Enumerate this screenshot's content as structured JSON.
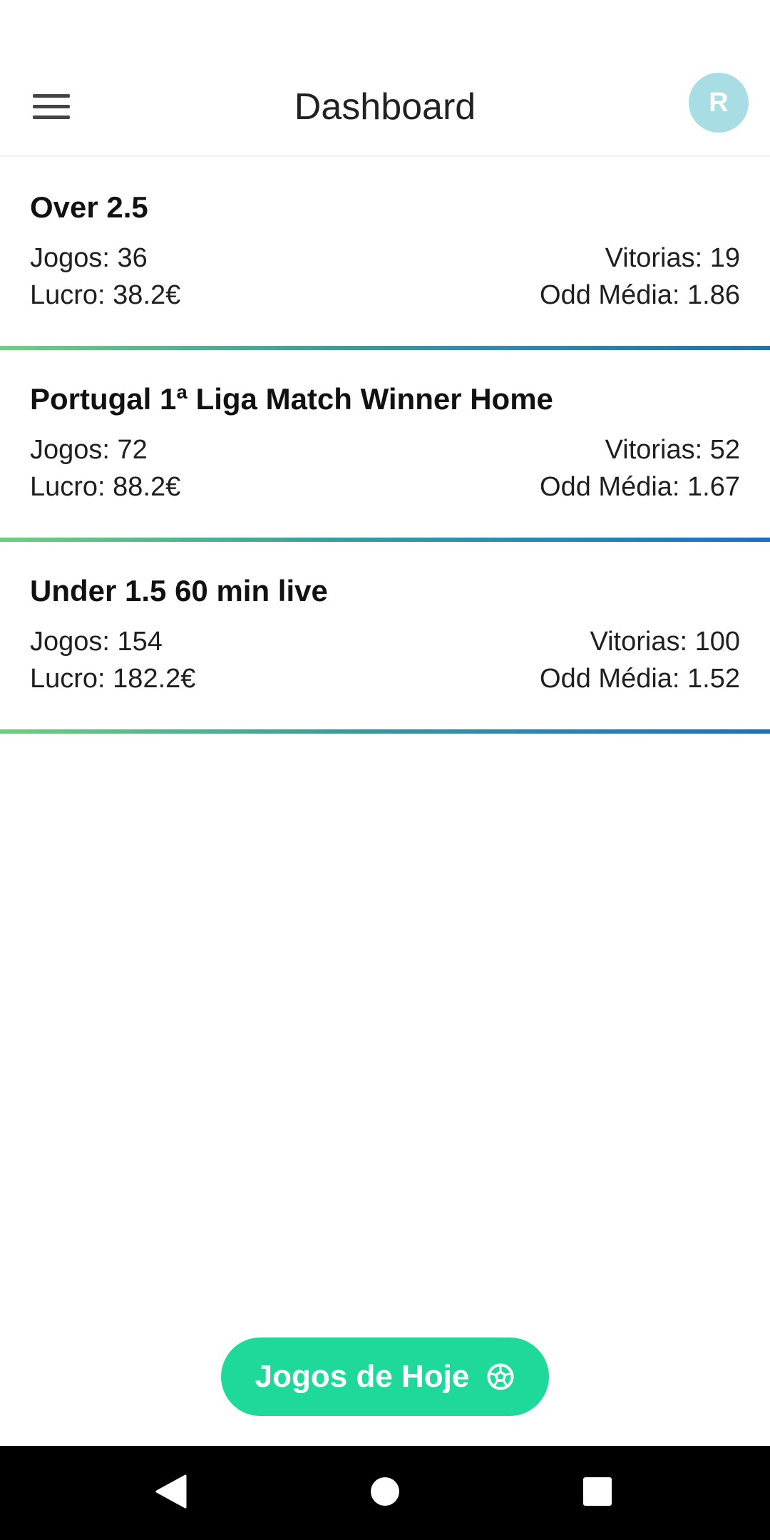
{
  "app_bar": {
    "title": "Dashboard",
    "menu_icon": "hamburger-menu-icon",
    "avatar_initial": "R",
    "avatar_color": "#a8dde3"
  },
  "strategies": [
    {
      "title": "Over 2.5",
      "jogos": "Jogos: 36",
      "vitorias": "Vitorias: 19",
      "lucro": "Lucro: 38.2€",
      "odd_media": "Odd Média: 1.86"
    },
    {
      "title": "Portugal 1ª Liga Match Winner Home",
      "jogos": "Jogos: 72",
      "vitorias": "Vitorias: 52",
      "lucro": "Lucro: 88.2€",
      "odd_media": "Odd Média: 1.67"
    },
    {
      "title": "Under 1.5 60 min live",
      "jogos": "Jogos: 154",
      "vitorias": "Vitorias: 100",
      "lucro": "Lucro: 182.2€",
      "odd_media": "Odd Média: 1.52"
    }
  ],
  "fab": {
    "label": "Jogos de Hoje",
    "icon": "soccer-ball-icon",
    "color": "#1fd99a"
  },
  "nav_bar": {
    "icons": [
      "back-triangle-icon",
      "home-circle-icon",
      "recents-square-icon"
    ]
  },
  "colors": {
    "divider_gradient_start": "#6fcf7f",
    "divider_gradient_end": "#1e6fc0"
  }
}
